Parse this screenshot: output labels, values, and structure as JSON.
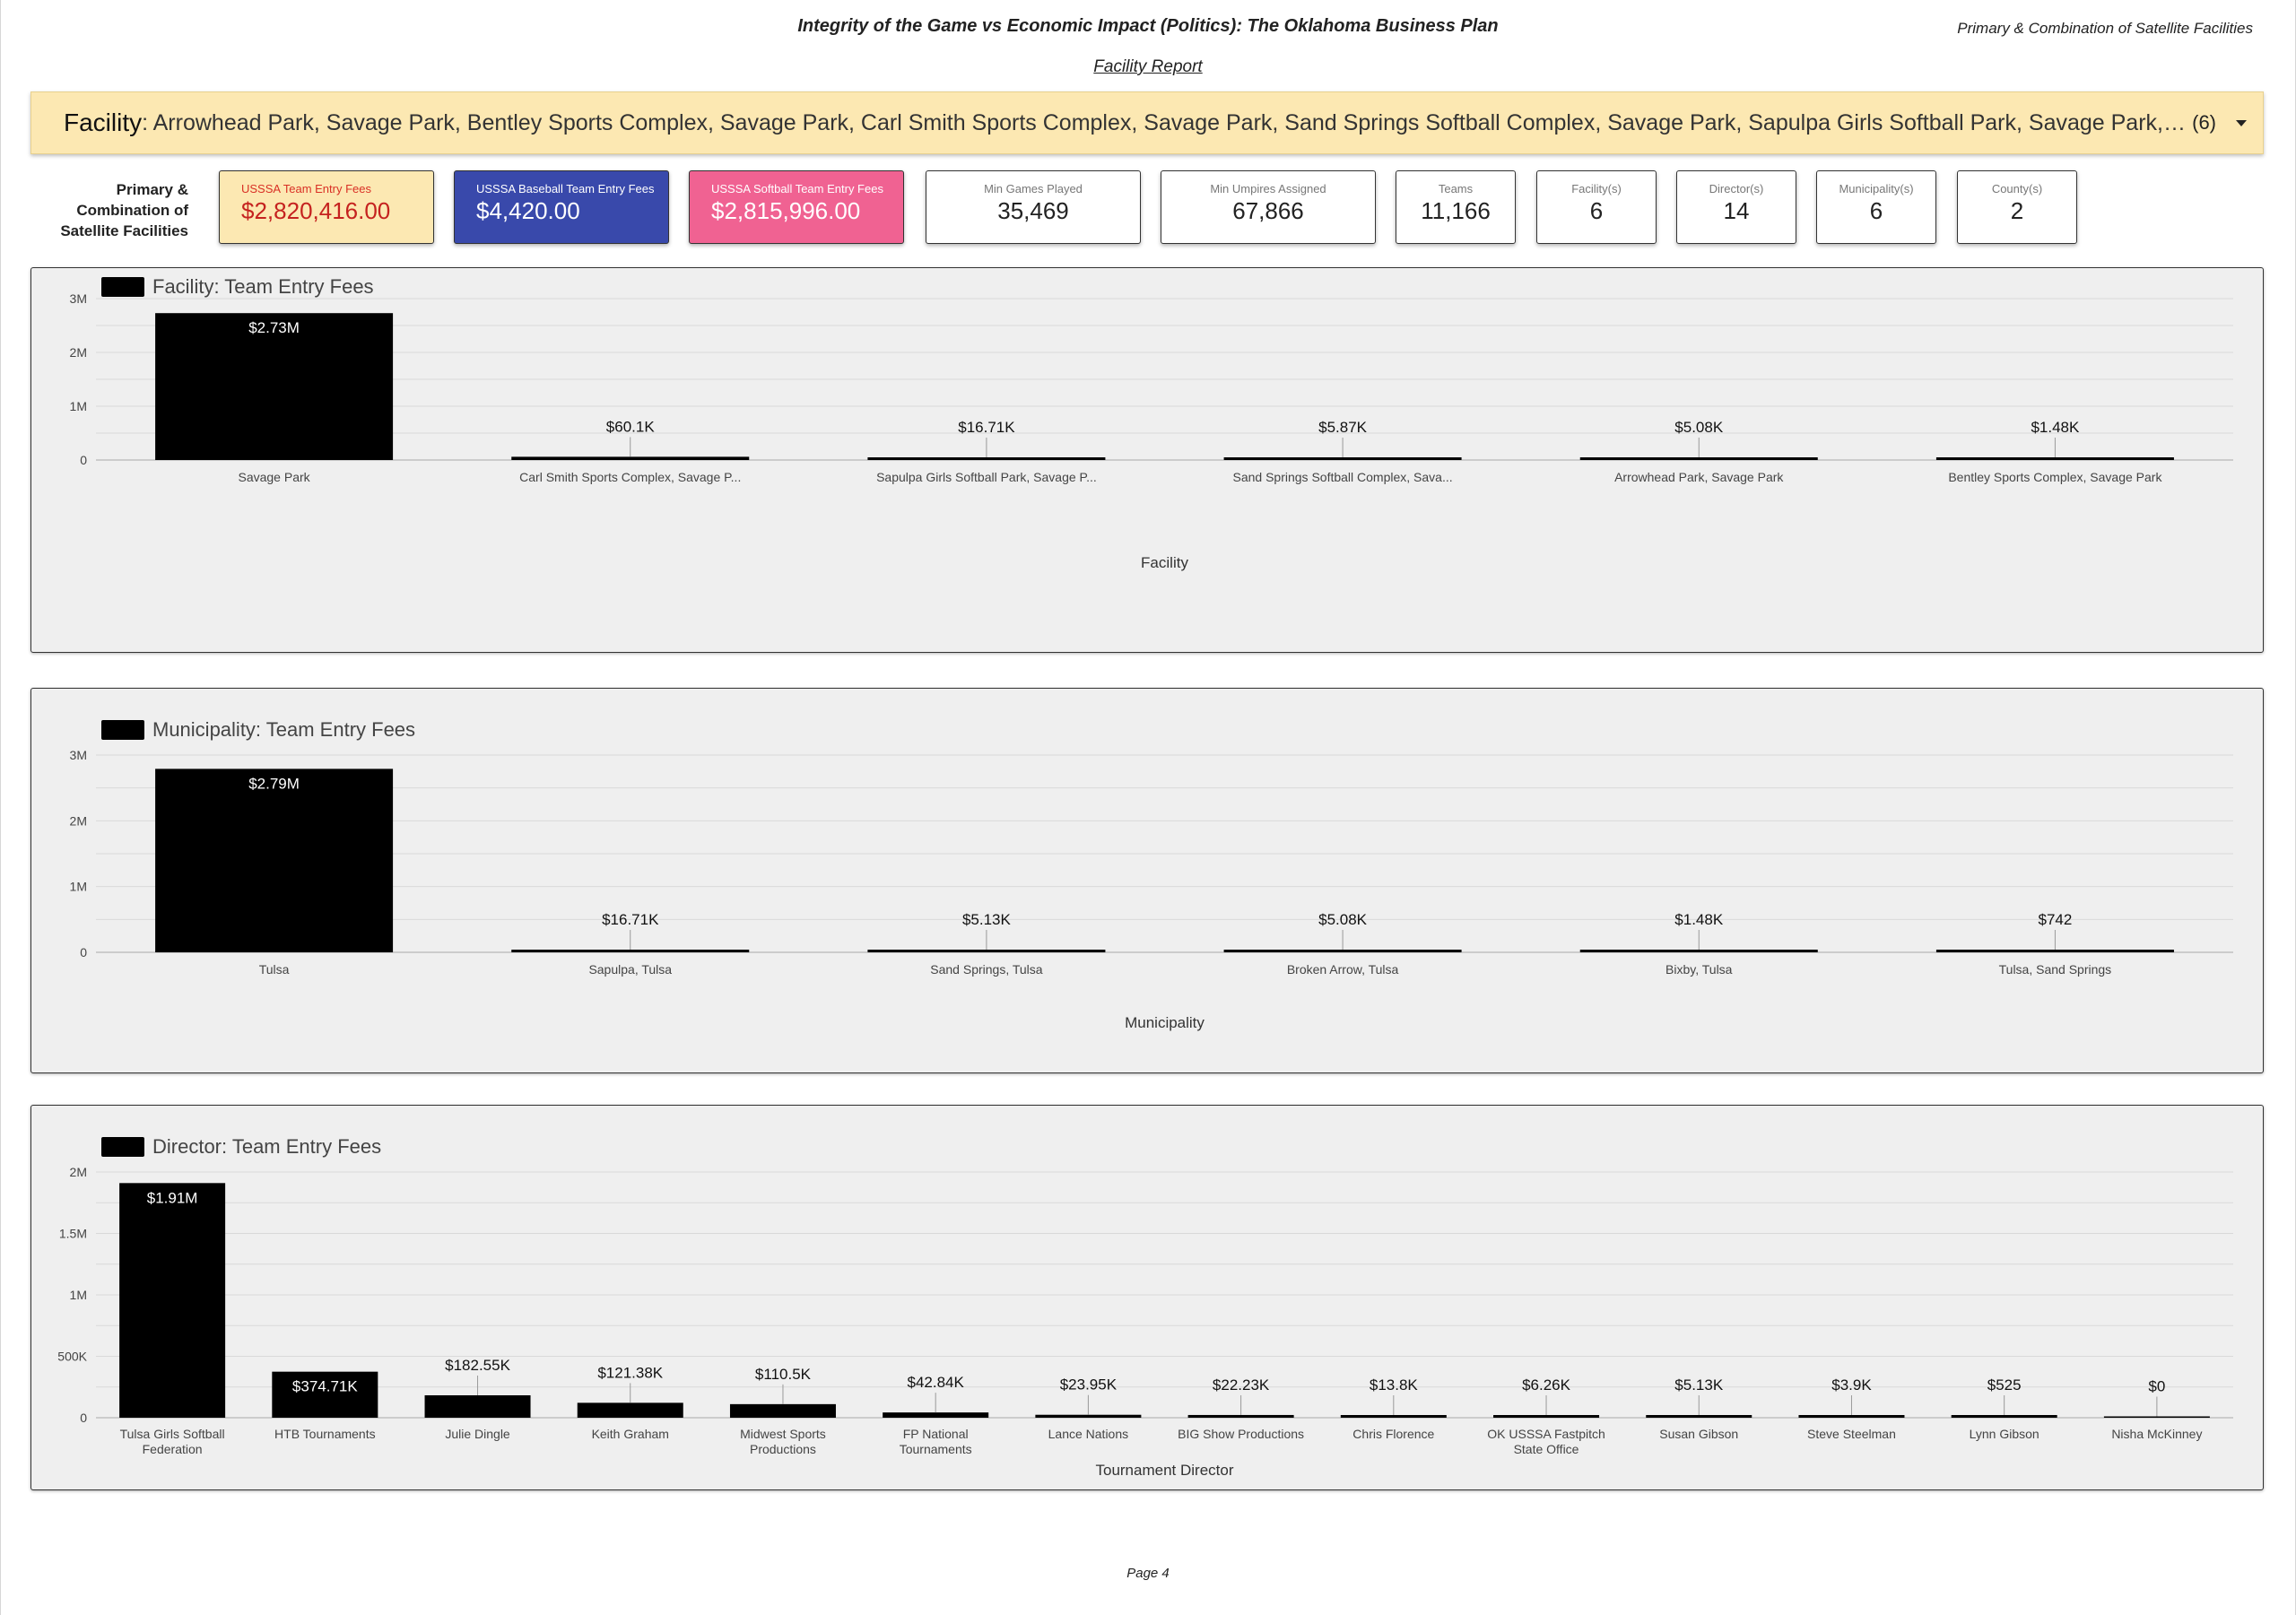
{
  "header": {
    "title": "Integrity of the Game vs Economic Impact (Politics): The Oklahoma Business Plan",
    "subtitle_right": "Primary & Combination of Satellite Facilities",
    "report_link": "Facility Report"
  },
  "filter": {
    "label": "Facility",
    "value": ": Arrowhead Park, Savage Park, Bentley Sports Complex, Savage Park, Carl Smith Sports Complex, Savage Park, Sand Springs Softball Complex, Savage Park, Sapulpa Girls Softball Park, Savage Park, Savage Park",
    "count": "(6)"
  },
  "side_label": {
    "line1": "Primary &",
    "line2": "Combination of",
    "line3": "Satellite Facilities"
  },
  "kpis": {
    "entry_fees": {
      "label": "USSSA Team Entry Fees",
      "value": "$2,820,416.00",
      "bg": "#fce8b2",
      "label_color": "#d93025",
      "value_color": "#c5221f"
    },
    "baseball_fees": {
      "label": "USSSA Baseball Team Entry Fees",
      "value": "$4,420.00",
      "bg": "#3949ab",
      "label_color": "#ffffff",
      "value_color": "#ffffff"
    },
    "softball_fees": {
      "label": "USSSA Softball Team Entry Fees",
      "value": "$2,815,996.00",
      "bg": "#f06292",
      "label_color": "#ffffff",
      "value_color": "#ffffff"
    },
    "min_games": {
      "label": "Min Games Played",
      "value": "35,469"
    },
    "min_umpires": {
      "label": "Min Umpires Assigned",
      "value": "67,866"
    },
    "teams": {
      "label": "Teams",
      "value": "11,166"
    },
    "facilities": {
      "label": "Facility(s)",
      "value": "6"
    },
    "directors": {
      "label": "Director(s)",
      "value": "14"
    },
    "municipalities": {
      "label": "Municipality(s)",
      "value": "6"
    },
    "counties": {
      "label": "County(s)",
      "value": "2"
    }
  },
  "colors": {
    "bar": "#000000",
    "panel_bg": "#efefef",
    "grid": "#d9d9d9"
  },
  "chart_data": [
    {
      "type": "bar",
      "legend": "Facility: Team Entry Fees",
      "xlabel": "Facility",
      "ylim": [
        0,
        3000000
      ],
      "yticks": [
        0,
        1000000,
        2000000,
        3000000
      ],
      "ytick_labels": [
        "0",
        "1M",
        "2M",
        "3M"
      ],
      "grid": true,
      "categories": [
        "Savage Park",
        "Carl Smith Sports Complex, Savage P...",
        "Sapulpa Girls Softball Park, Savage P...",
        "Sand Springs Softball Complex, Sava...",
        "Arrowhead Park, Savage Park",
        "Bentley Sports Complex, Savage Park"
      ],
      "values": [
        2730000,
        60100,
        16710,
        5870,
        5080,
        1480
      ],
      "data_labels": [
        "$2.73M",
        "$60.1K",
        "$16.71K",
        "$5.87K",
        "$5.08K",
        "$1.48K"
      ]
    },
    {
      "type": "bar",
      "legend": "Municipality: Team Entry Fees",
      "xlabel": "Municipality",
      "ylim": [
        0,
        3000000
      ],
      "yticks": [
        0,
        1000000,
        2000000,
        3000000
      ],
      "ytick_labels": [
        "0",
        "1M",
        "2M",
        "3M"
      ],
      "grid": true,
      "categories": [
        "Tulsa",
        "Sapulpa, Tulsa",
        "Sand Springs, Tulsa",
        "Broken Arrow, Tulsa",
        "Bixby, Tulsa",
        "Tulsa, Sand Springs"
      ],
      "values": [
        2790000,
        16710,
        5130,
        5080,
        1480,
        742
      ],
      "data_labels": [
        "$2.79M",
        "$16.71K",
        "$5.13K",
        "$5.08K",
        "$1.48K",
        "$742"
      ]
    },
    {
      "type": "bar",
      "legend": "Director: Team Entry Fees",
      "xlabel": "Tournament Director",
      "ylim": [
        0,
        2000000
      ],
      "yticks": [
        0,
        500000,
        1000000,
        1500000,
        2000000
      ],
      "ytick_labels": [
        "0",
        "500K",
        "1M",
        "1.5M",
        "2M"
      ],
      "grid": true,
      "categories": [
        "Tulsa Girls Softball Federation",
        "HTB Tournaments",
        "Julie Dingle",
        "Keith Graham",
        "Midwest Sports Productions",
        "FP National Tournaments",
        "Lance Nations",
        "BIG Show Productions",
        "Chris Florence",
        "OK USSSA Fastpitch State Office",
        "Susan Gibson",
        "Steve Steelman",
        "Lynn Gibson",
        "Nisha McKinney"
      ],
      "values": [
        1910000,
        374710,
        182550,
        121380,
        110500,
        42840,
        23950,
        22230,
        13800,
        6260,
        5130,
        3900,
        525,
        0
      ],
      "data_labels": [
        "$1.91M",
        "$374.71K",
        "$182.55K",
        "$121.38K",
        "$110.5K",
        "$42.84K",
        "$23.95K",
        "$22.23K",
        "$13.8K",
        "$6.26K",
        "$5.13K",
        "$3.9K",
        "$525",
        "$0"
      ]
    }
  ],
  "footer": {
    "page": "Page 4"
  }
}
